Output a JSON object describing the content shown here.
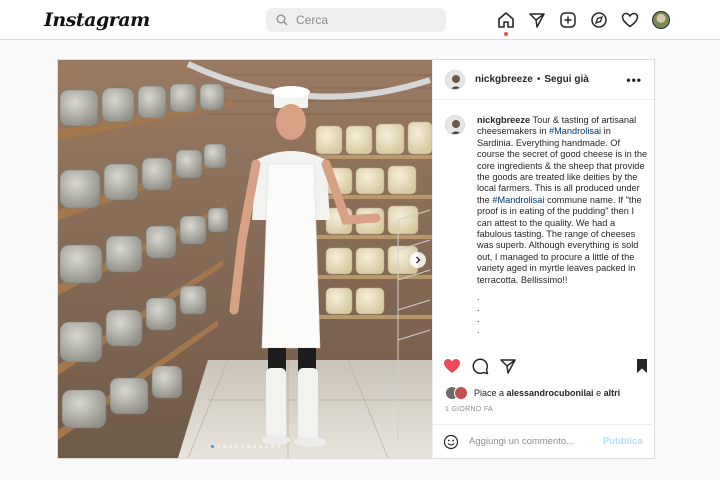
{
  "app": {
    "logo_text": "Instagram"
  },
  "search": {
    "placeholder": "Cerca"
  },
  "nav": {
    "icons": [
      "home-icon",
      "direct-icon",
      "new-post-icon",
      "explore-icon",
      "activity-heart-icon",
      "profile-avatar"
    ]
  },
  "post": {
    "username": "nickgbreeze",
    "separator": "•",
    "follow_label": "Segui già",
    "more_label": "•••",
    "caption": {
      "username": "nickgbreeze",
      "part1": " Tour & tasting of artisanal cheesemakers in ",
      "tag1": "#Mandrolisai",
      "part2": " in Sardinia. Everything handmade. Of course the secret of good cheese is in the core ingredients & the sheep that provide the goods are treated like deities by the local farmers. This is all produced under the ",
      "tag2": "#Mandrolisai",
      "part3": " commune name. If \"the proof is in eating of the pudding\" then I can attest to the quality. We had a fabulous tasting. The range of cheeses was superb. Although everything is sold out, I managed to procure a little of the variety aged in myrtle leaves packed in terracotta. Bellissimo!!",
      "dots": [
        ".",
        ".",
        ".",
        "."
      ]
    },
    "likes": {
      "prefix": "Piace a ",
      "user": "alessandrocubonilai",
      "suffix": " e ",
      "others": "altri"
    },
    "time_ago": "1 GIORNO FA",
    "comment": {
      "placeholder": "Aggiungi un commento...",
      "publish_label": "Pubblica"
    },
    "carousel": {
      "count": 12,
      "active_index": 0
    }
  },
  "colors": {
    "like_red": "#ed4956",
    "link_blue": "#00376b",
    "publish_blue": "#b2dffc",
    "dot_active": "#3897f0"
  }
}
